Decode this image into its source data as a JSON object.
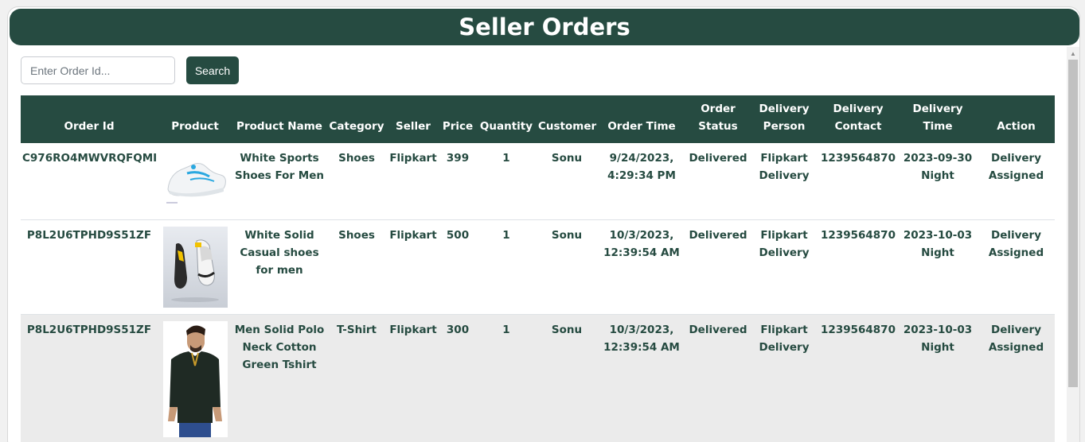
{
  "header": {
    "title": "Seller Orders"
  },
  "search": {
    "placeholder": "Enter Order Id...",
    "value": "",
    "button_label": "Search"
  },
  "table": {
    "columns": [
      "Order Id",
      "Product",
      "Product Name",
      "Category",
      "Seller",
      "Price",
      "Quantity",
      "Customer",
      "Order Time",
      "Order Status",
      "Delivery Person",
      "Delivery Contact",
      "Delivery Time",
      "Action"
    ],
    "rows": [
      {
        "order_id": "C976RO4MWVRQFQMI",
        "product_image": "white-sports-shoe-image",
        "product_name": "White Sports Shoes For Men",
        "category": "Shoes",
        "seller": "Flipkart",
        "price": "399",
        "quantity": "1",
        "customer": "Sonu",
        "order_time": "9/24/2023, 4:29:34 PM",
        "order_status": "Delivered",
        "delivery_person": "Flipkart Delivery",
        "delivery_contact": "1239564870",
        "delivery_time": "2023-09-30 Night",
        "action": "Delivery Assigned"
      },
      {
        "order_id": "P8L2U6TPHD9S51ZF",
        "product_image": "white-casual-shoe-image",
        "product_name": "White Solid Casual shoes for men",
        "category": "Shoes",
        "seller": "Flipkart",
        "price": "500",
        "quantity": "1",
        "customer": "Sonu",
        "order_time": "10/3/2023, 12:39:54 AM",
        "order_status": "Delivered",
        "delivery_person": "Flipkart Delivery",
        "delivery_contact": "1239564870",
        "delivery_time": "2023-10-03 Night",
        "action": "Delivery Assigned"
      },
      {
        "order_id": "P8L2U6TPHD9S51ZF",
        "product_image": "green-polo-tshirt-image",
        "product_name": "Men Solid Polo Neck Cotton Green Tshirt",
        "category": "T-Shirt",
        "seller": "Flipkart",
        "price": "300",
        "quantity": "1",
        "customer": "Sonu",
        "order_time": "10/3/2023, 12:39:54 AM",
        "order_status": "Delivered",
        "delivery_person": "Flipkart Delivery",
        "delivery_contact": "1239564870",
        "delivery_time": "2023-10-03 Night",
        "action": "Delivery Assigned"
      }
    ]
  },
  "colors": {
    "primary": "#264b41",
    "highlight_row": "#ebebeb",
    "text": "#264b41"
  }
}
